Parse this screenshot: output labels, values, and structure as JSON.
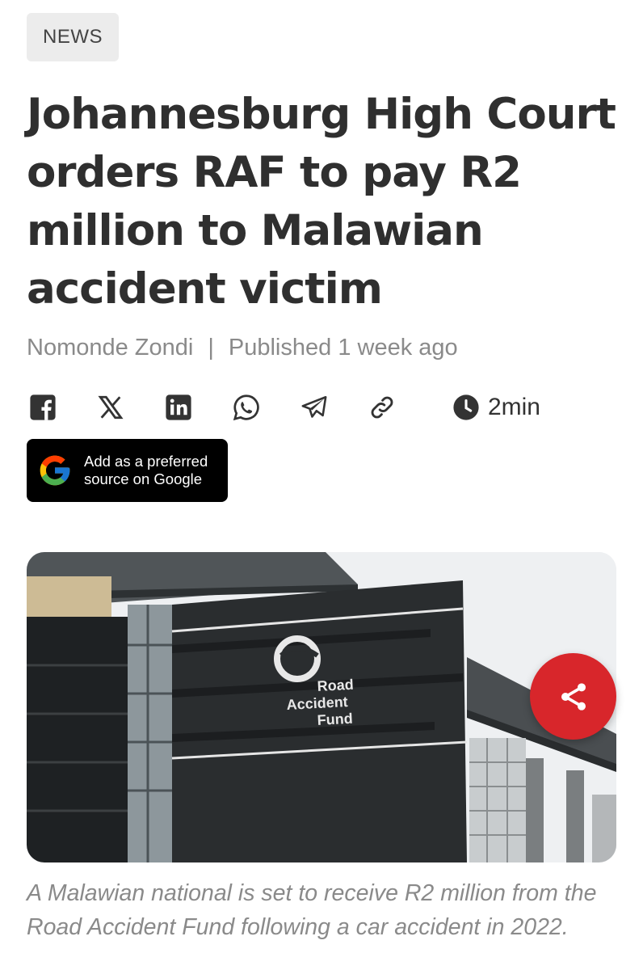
{
  "category": {
    "label": "NEWS"
  },
  "article": {
    "headline": "Johannesburg High Court orders RAF to pay R2 million to Malawian accident victim",
    "author": "Nomonde Zondi",
    "separator": "|",
    "published": "Published 1 week ago",
    "read_time": "2min",
    "caption": "A Malawian national is set to receive R2 million from the Road Accident Fund following a car accident in 2022."
  },
  "share_icons": [
    "facebook-icon",
    "x-icon",
    "linkedin-icon",
    "whatsapp-icon",
    "telegram-icon",
    "link-icon"
  ],
  "google_source": {
    "line1": "Add as a preferred",
    "line2": "source on Google"
  },
  "image": {
    "sign_line1": "Road",
    "sign_line2": "Accident",
    "sign_line3": "Fund"
  },
  "colors": {
    "share_fab": "#d8262b",
    "tag_bg": "#ececec",
    "button_bg": "#000000"
  }
}
